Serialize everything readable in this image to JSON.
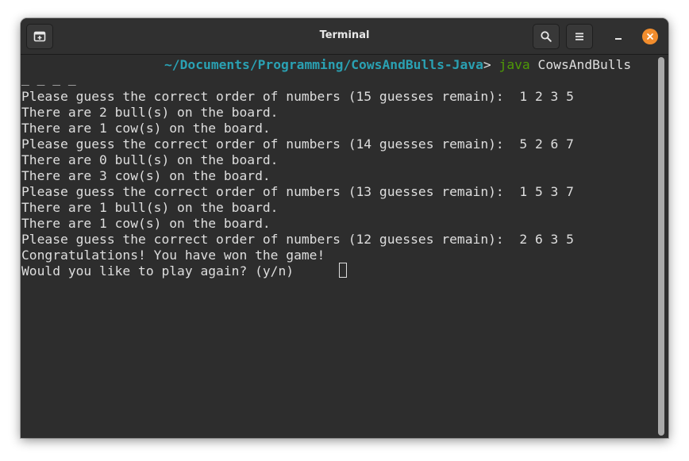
{
  "window": {
    "title": "Terminal"
  },
  "header": {
    "new_tab_icon": "new-tab-icon",
    "search_icon": "search-icon",
    "menu_icon": "hamburger-menu-icon",
    "minimize_icon": "minimize-icon",
    "close_icon": "close-icon"
  },
  "colors": {
    "path": "#2aa1b3",
    "command_bin": "#4e9a06",
    "close_button": "#f28d2d",
    "text": "#dedede",
    "background": "#2d2d2d"
  },
  "terminal": {
    "prompt_path": "~/Documents/Programming/CowsAndBulls-Java",
    "prompt_symbol": ">",
    "command_bin": "java",
    "command_arg": "CowsAndBulls",
    "output": [
      "_ _ _ _",
      "Please guess the correct order of numbers (15 guesses remain):  1 2 3 5",
      "There are 2 bull(s) on the board.",
      "There are 1 cow(s) on the board.",
      "Please guess the correct order of numbers (14 guesses remain):  5 2 6 7",
      "There are 0 bull(s) on the board.",
      "There are 3 cow(s) on the board.",
      "Please guess the correct order of numbers (13 guesses remain):  1 5 3 7",
      "There are 1 bull(s) on the board.",
      "There are 1 cow(s) on the board.",
      "Please guess the correct order of numbers (12 guesses remain):  2 6 3 5",
      "Congratulations! You have won the game!",
      "Would you like to play again? (y/n)"
    ]
  }
}
